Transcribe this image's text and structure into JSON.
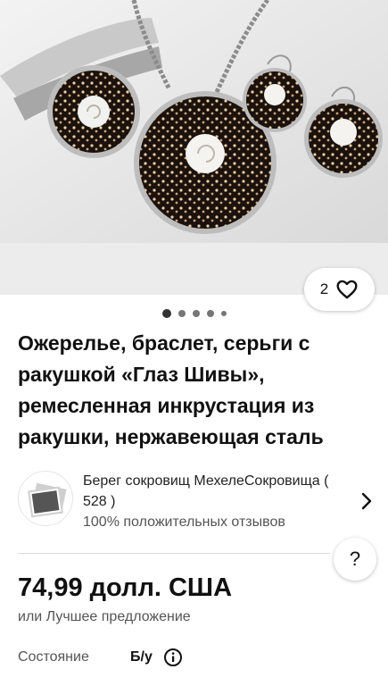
{
  "listing": {
    "image_alt": "Shell jewelry set: necklace, bracelet and earrings",
    "like_count": "2",
    "gallery_page_count": 5,
    "gallery_active_index": 0,
    "title": "Ожерелье, браслет, серьги с ракушкой «Глаз Шивы», ремесленная инкрустация из ракушки, нержавеющая сталь"
  },
  "seller": {
    "name_line": "Берег сокровищ МехелеСокровища ( 528 )",
    "feedback": "100% положительных отзывов"
  },
  "price": {
    "amount": "74,99 долл. США",
    "best_offer": "или Лучшее предложение"
  },
  "condition": {
    "label": "Состояние",
    "value": "Б/у"
  },
  "icons": {
    "like": "heart-icon",
    "help": "question-icon",
    "seller_arrow": "chevron-right-icon",
    "info": "info-icon"
  },
  "colors": {
    "text": "#111111",
    "secondary_text": "#555555",
    "gallery_bg": "#ececec"
  }
}
